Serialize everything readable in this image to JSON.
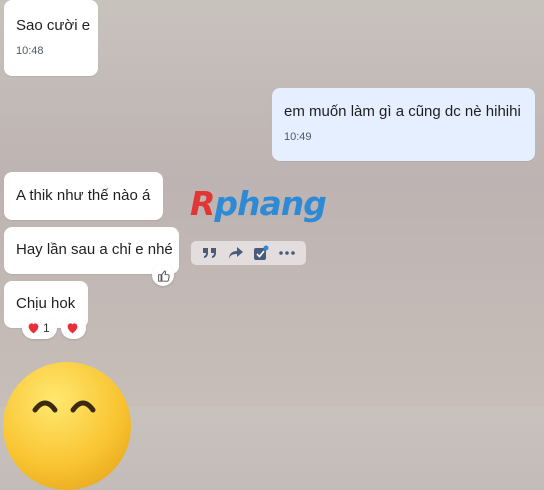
{
  "messages": [
    {
      "id": "m1",
      "side": "left",
      "text": "Sao cười e",
      "time": "10:48"
    },
    {
      "id": "m2",
      "side": "right",
      "text": "em muốn làm gì a cũng dc nè hihihi",
      "time": "10:49"
    },
    {
      "id": "m3",
      "side": "left",
      "text": "A thik như thế nào á"
    },
    {
      "id": "m4",
      "side": "left",
      "text": "Hay lần sau a chỉ e nhé"
    },
    {
      "id": "m5",
      "side": "left",
      "text": "Chịu hok"
    }
  ],
  "watermark": {
    "first": "R",
    "rest": "phang"
  },
  "message_toolbar": [
    "quote-icon",
    "forward-icon",
    "select-icon",
    "more-icon"
  ],
  "reactions": {
    "heart_count": "1"
  },
  "colors": {
    "outgoing_bubble": "#e5efff",
    "incoming_bubble": "#ffffff",
    "heart": "#e8303a",
    "watermark_red": "#e23636",
    "watermark_blue": "#2f8ad6"
  }
}
